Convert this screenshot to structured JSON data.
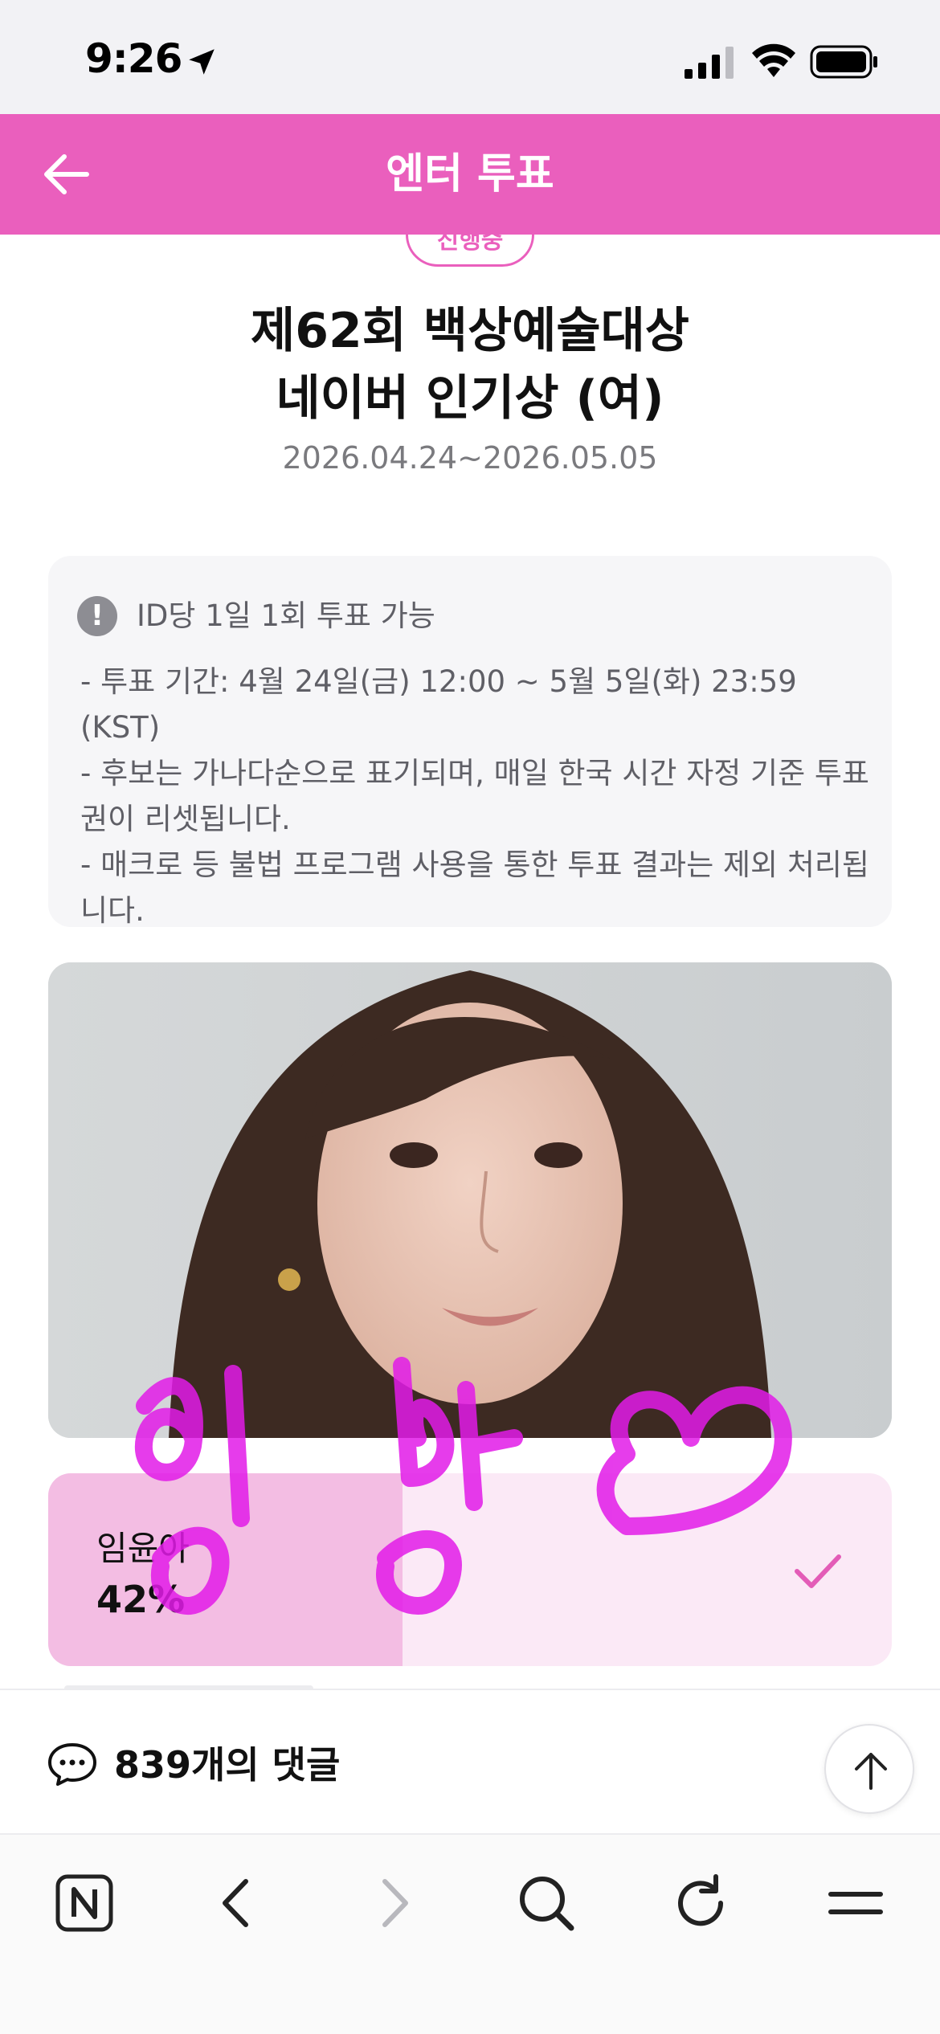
{
  "status_bar": {
    "time": "9:26"
  },
  "header": {
    "title": "엔터 투표",
    "accent_color": "#ea5fbd"
  },
  "poll": {
    "status_chip": "진행중",
    "title_line1": "제62회 백상예술대상",
    "title_line2": "네이버 인기상 (여)",
    "period": "2026.04.24~2026.05.05"
  },
  "notice": {
    "heading": "ID당 1일 1회 투표 가능",
    "lines": [
      "- 투표 기간: 4월 24일(금) 12:00 ~ 5월 5일(화) 23:59 (KST)",
      "- 후보는 가나다순으로 표기되며, 매일 한국 시간 자정 기준 투표권이 리셋됩니다.",
      "- 매크로 등 불법 프로그램 사용을 통한 투표 결과는 제외 처리됩니다."
    ]
  },
  "candidate": {
    "name": "임윤아",
    "percent_label": "42%",
    "percent_value": 42,
    "selected": true
  },
  "comments": {
    "label": "839개의 댓글"
  },
  "browser_toolbar": {
    "icons": [
      "naver-n-icon",
      "back-icon",
      "forward-icon",
      "search-icon",
      "reload-icon",
      "menu-icon"
    ]
  }
}
